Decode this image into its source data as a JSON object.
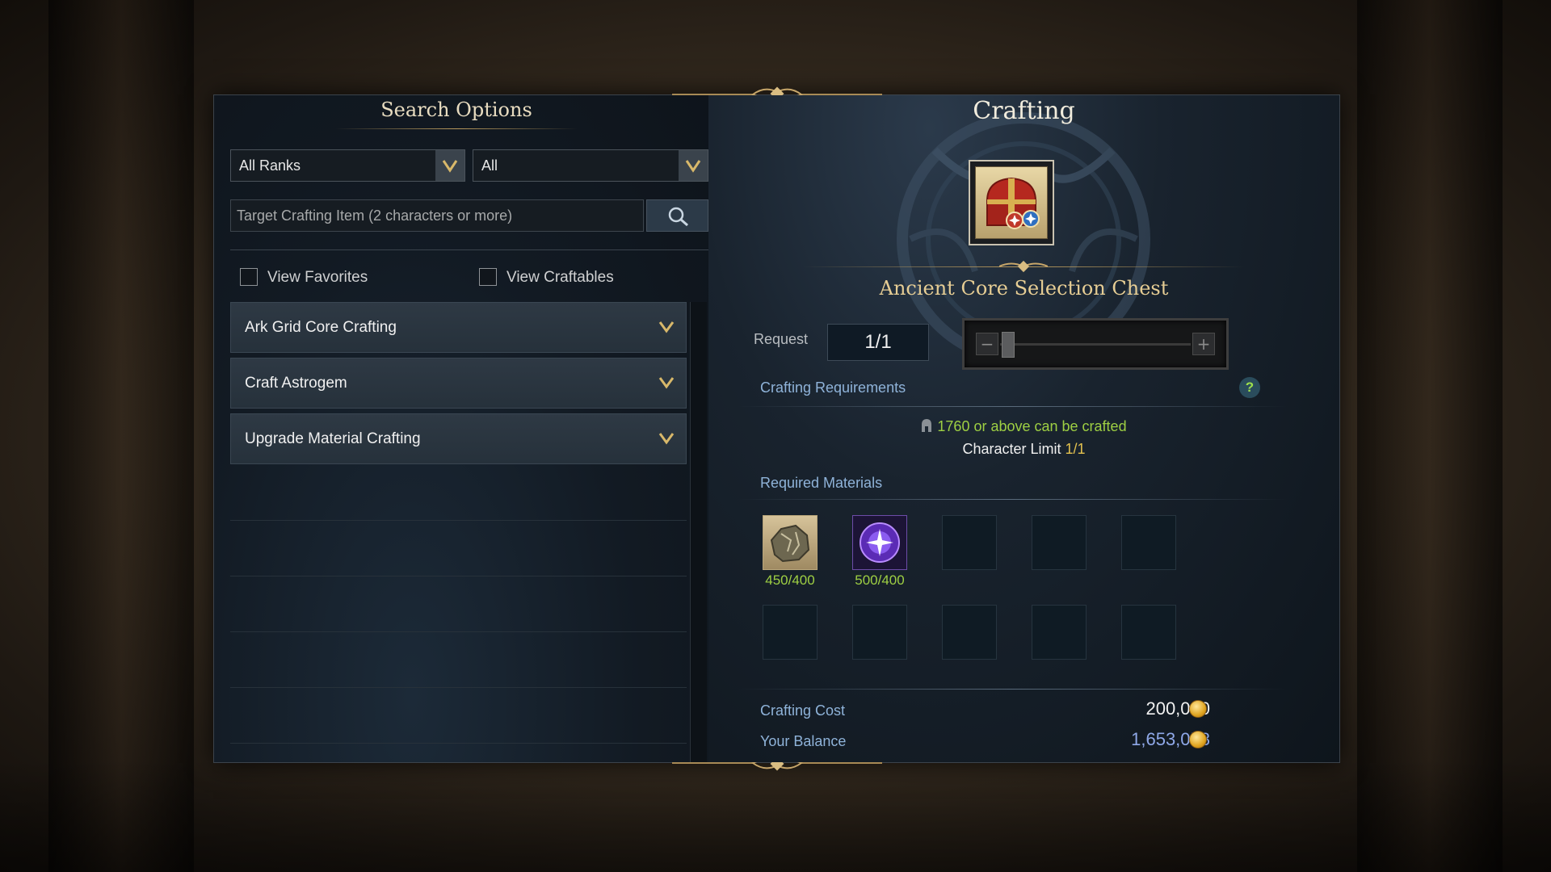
{
  "search_panel": {
    "title": "Search Options",
    "rank_dropdown": "All Ranks",
    "type_dropdown": "All",
    "search_placeholder": "Target Crafting Item (2 characters or more)",
    "view_favorites": "View Favorites",
    "view_craftables": "View Craftables",
    "categories": [
      {
        "label": "Ark Grid Core Crafting"
      },
      {
        "label": "Craft Astrogem"
      },
      {
        "label": "Upgrade Material Crafting"
      }
    ]
  },
  "crafting_panel": {
    "title": "Crafting",
    "item_name": "Ancient Core Selection Chest",
    "request_label": "Request",
    "request_value": "1/1",
    "slider_minus": "−",
    "slider_plus": "+",
    "requirements_heading": "Crafting Requirements",
    "help_symbol": "?",
    "condition_text": "1760 or above can be crafted",
    "character_limit_label": "Character Limit",
    "character_limit_value": "1/1",
    "materials_heading": "Required Materials",
    "materials": [
      {
        "icon": "ore-chunk-icon",
        "count": "450/400"
      },
      {
        "icon": "purple-orb-icon",
        "count": "500/400"
      }
    ],
    "crafting_cost_label": "Crafting Cost",
    "crafting_cost_value": "200,000",
    "balance_label": "Your Balance",
    "balance_value": "1,653,058"
  },
  "colors": {
    "gold_text": "#e6cd94",
    "requirement_green": "#9ecf43",
    "label_blue": "#8fb3d9",
    "balance_blue": "#8fa8e8",
    "limit_yellow": "#e2c14f"
  }
}
